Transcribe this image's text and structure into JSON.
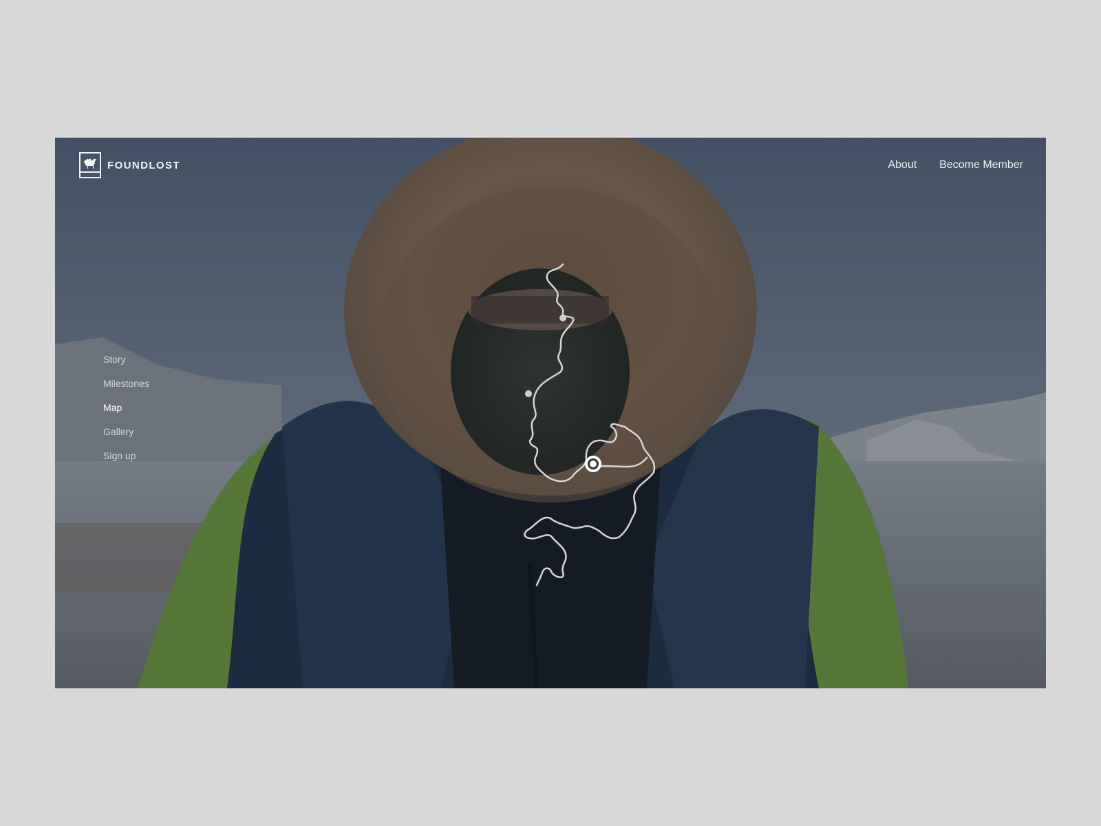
{
  "brand": {
    "name": "FOUNDLOST",
    "logo_icon": "camel-icon"
  },
  "topnav": {
    "about": "About",
    "become_member": "Become Member"
  },
  "sidenav": {
    "items": [
      {
        "label": "Story",
        "active": false
      },
      {
        "label": "Milestones",
        "active": false
      },
      {
        "label": "Map",
        "active": true
      },
      {
        "label": "Gallery",
        "active": false
      },
      {
        "label": "Sign up",
        "active": false
      }
    ]
  },
  "hero": {
    "image": "person-in-fur-hood-photo"
  },
  "map": {
    "icon": "route-path-icon",
    "current_location_icon": "location-target-icon"
  },
  "colors": {
    "overlay": "#141c28",
    "text": "#f1f1f1",
    "jacket_green": "#7fa84a",
    "jacket_blue": "#1f3148",
    "fur": "#8c6c4e",
    "route": "#d6d6d6"
  }
}
